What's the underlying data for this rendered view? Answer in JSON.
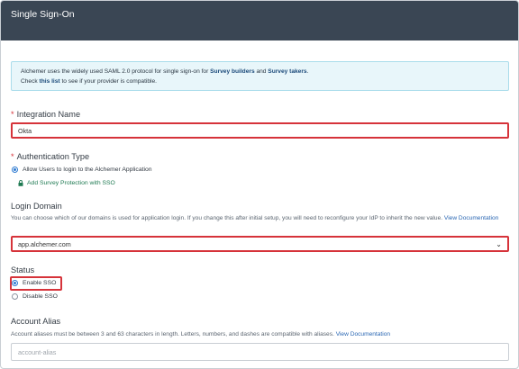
{
  "header": {
    "title": "Single Sign-On"
  },
  "info": {
    "line1_prefix": "Alchemer uses the widely used SAML 2.0 protocol for single sign-on for ",
    "line1_link1": "Survey builders",
    "line1_mid": " and ",
    "line1_link2": "Survey takers",
    "line1_suffix": ".",
    "line2_prefix": "Check ",
    "line2_link": "this list",
    "line2_suffix": " to see if your provider is compatible."
  },
  "integration_name": {
    "required_mark": "*",
    "label": "Integration Name",
    "value": "Okta"
  },
  "authentication_type": {
    "required_mark": "*",
    "label": "Authentication Type",
    "option_allow_users": "Allow Users to login to the Alchemer Application",
    "add_protection": "Add Survey Protection with SSO"
  },
  "login_domain": {
    "label": "Login Domain",
    "help": "You can choose which of our domains is used for application login. If you change this after initial setup, you will need to reconfigure your IdP to inherit the new value.",
    "help_link": "View Documentation",
    "selected": "app.alchemer.com"
  },
  "status": {
    "label": "Status",
    "enable": "Enable SSO",
    "disable": "Disable SSO"
  },
  "account_alias": {
    "label": "Account Alias",
    "help": "Account aliases must be between 3 and 63 characters in length. Letters, numbers, and dashes are compatible with aliases.",
    "help_link": "View Documentation",
    "placeholder": "account-alias"
  },
  "colors": {
    "header_bg": "#3a4654",
    "highlight_red": "#d6333a",
    "info_bg": "#e8f6fa",
    "link_blue": "#2a67b3",
    "sso_green": "#1f7a52"
  }
}
